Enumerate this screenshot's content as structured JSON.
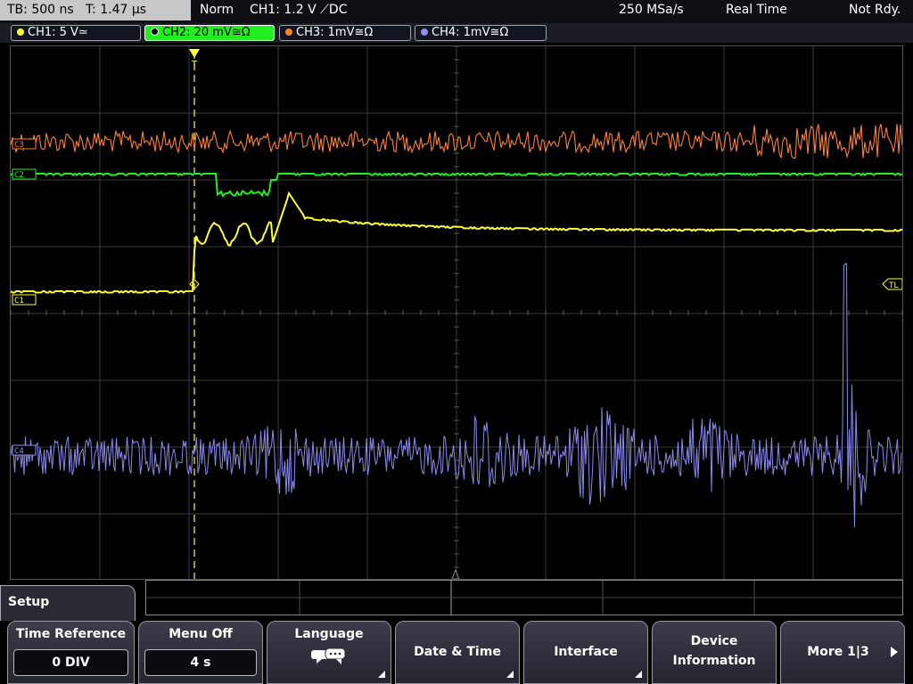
{
  "status": {
    "timebase": "TB: 500 ns",
    "trigger_time": "T: 1.47 µs",
    "mode": "Norm",
    "trigger": "CH1: 1.2 V ⟋DC",
    "sample_rate": "250 MSa/s",
    "acq_mode": "Real Time",
    "state": "Not Rdy."
  },
  "channels": [
    {
      "label": "CH1: 5 V≃",
      "color": "#ffff33"
    },
    {
      "label": "CH2: 20 mV≅Ω",
      "color": "#22ee22"
    },
    {
      "label": "CH3: 1mV≅Ω",
      "color": "#ff8030"
    },
    {
      "label": "CH4: 1mV≅Ω",
      "color": "#8f8fef"
    }
  ],
  "markers": {
    "ch1": "C1",
    "ch2": "C2",
    "ch3": "C3",
    "ch4": "C4",
    "trigger_level": "TL",
    "trigger_pos": "T"
  },
  "menu": {
    "title": "Setup",
    "softkeys": [
      {
        "label": "Time Reference",
        "value": "0 DIV"
      },
      {
        "label": "Menu Off",
        "value": "4 s"
      },
      {
        "label": "Language",
        "icon": "speech-bubble-icon"
      },
      {
        "label": "Date & Time"
      },
      {
        "label": "Interface"
      },
      {
        "label_line1": "Device",
        "label_line2": "Information"
      },
      {
        "label": "More 1|3"
      }
    ]
  }
}
